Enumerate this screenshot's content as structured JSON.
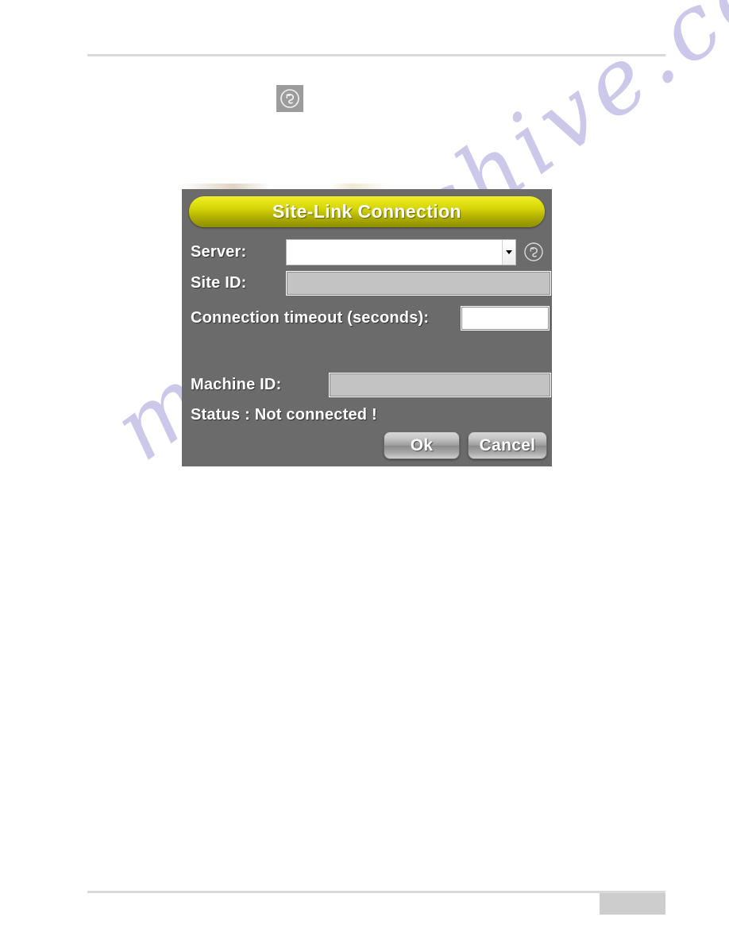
{
  "page": {
    "has_top_rule": true,
    "has_bottom_rule": true,
    "footer_page_block": "",
    "watermark": "manualshive.com",
    "background_color": "#ffffff",
    "rule_color": "#d9d9d9"
  },
  "section_icon": {
    "name": "site-link-icon",
    "background_color": "#9c9c9c"
  },
  "dialog": {
    "title": "Site-Link Connection",
    "background_color": "#6b6b6b",
    "title_gradient_from": "#efef2a",
    "title_gradient_to": "#8f8f00",
    "fields": {
      "server": {
        "label": "Server:",
        "value": "",
        "placeholder": "",
        "type": "combobox",
        "browse_icon": "site-link-icon"
      },
      "site_id": {
        "label": "Site ID:",
        "value": "",
        "type": "text",
        "disabled": true
      },
      "connection_timeout": {
        "label": "Connection timeout (seconds):",
        "value": "",
        "type": "text",
        "disabled": false
      },
      "machine_id": {
        "label": "Machine ID:",
        "value": "",
        "type": "text",
        "disabled": true
      }
    },
    "status": {
      "label": "Status : Not connected !"
    },
    "buttons": {
      "ok": "Ok",
      "cancel": "Cancel"
    }
  }
}
